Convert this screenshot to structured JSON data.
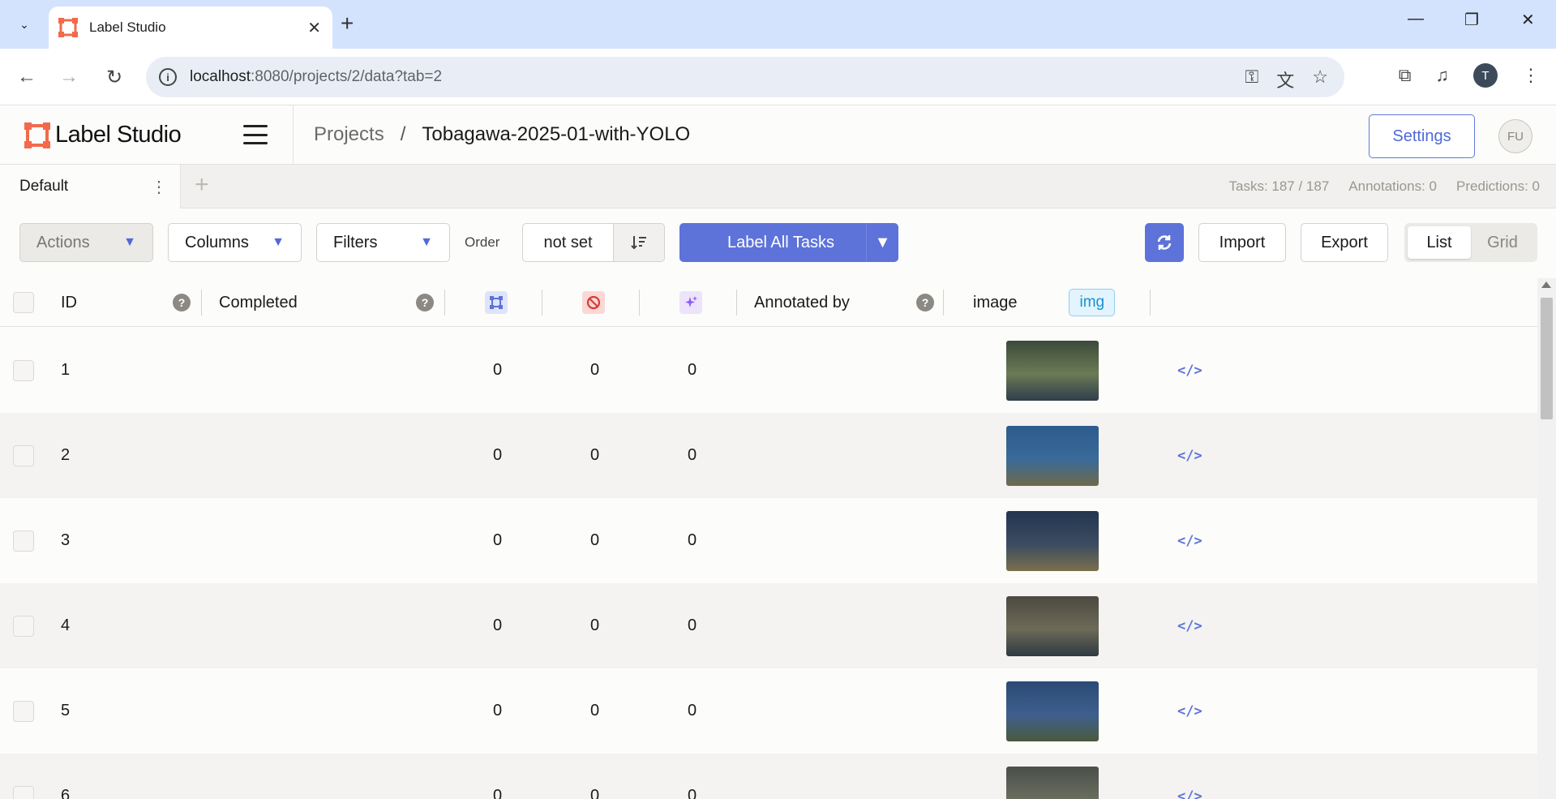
{
  "browser": {
    "tab_title": "Label Studio",
    "url_host": "localhost",
    "url_path": ":8080/projects/2/data?tab=2",
    "profile_initial": "T"
  },
  "app": {
    "logo_text": "Label Studio",
    "breadcrumb": {
      "projects": "Projects",
      "separator": "/",
      "current": "Tobagawa-2025-01-with-YOLO"
    },
    "settings_label": "Settings",
    "avatar_initials": "FU"
  },
  "views": {
    "active_tab": "Default",
    "stats": {
      "tasks": "Tasks: 187 / 187",
      "annotations": "Annotations: 0",
      "predictions": "Predictions: 0"
    }
  },
  "toolbar": {
    "actions": "Actions",
    "columns": "Columns",
    "filters": "Filters",
    "order_label": "Order",
    "order_value": "not set",
    "label_all": "Label All Tasks",
    "import": "Import",
    "export": "Export",
    "view_list": "List",
    "view_grid": "Grid"
  },
  "table": {
    "headers": {
      "id": "ID",
      "completed": "Completed",
      "annotated_by": "Annotated by",
      "image": "image",
      "image_tag": "img"
    },
    "rows": [
      {
        "id": "1",
        "total": "0",
        "cancelled": "0",
        "predictions": "0"
      },
      {
        "id": "2",
        "total": "0",
        "cancelled": "0",
        "predictions": "0"
      },
      {
        "id": "3",
        "total": "0",
        "cancelled": "0",
        "predictions": "0"
      },
      {
        "id": "4",
        "total": "0",
        "cancelled": "0",
        "predictions": "0"
      },
      {
        "id": "5",
        "total": "0",
        "cancelled": "0",
        "predictions": "0"
      },
      {
        "id": "6",
        "total": "0",
        "cancelled": "0",
        "predictions": "0"
      }
    ]
  },
  "colors": {
    "accent": "#5d73d9",
    "logo": "#f26a4b"
  }
}
